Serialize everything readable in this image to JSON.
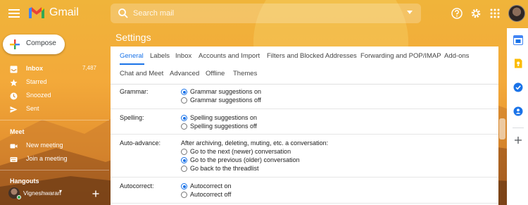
{
  "header": {
    "app_name": "Gmail",
    "search_placeholder": "Search mail"
  },
  "nav": {
    "compose_label": "Compose",
    "items": [
      {
        "label": "Inbox",
        "count": "7,487",
        "icon": "inbox-icon",
        "active": true
      },
      {
        "label": "Starred",
        "icon": "star-icon"
      },
      {
        "label": "Snoozed",
        "icon": "clock-icon"
      },
      {
        "label": "Sent",
        "icon": "send-icon"
      }
    ],
    "meet": {
      "heading": "Meet",
      "items": [
        {
          "label": "New meeting",
          "icon": "video-icon"
        },
        {
          "label": "Join a meeting",
          "icon": "keyboard-icon"
        }
      ]
    },
    "hangouts": {
      "heading": "Hangouts",
      "user": "Vigneshwaran"
    }
  },
  "settings": {
    "title": "Settings",
    "tabs": [
      {
        "label": "General",
        "active": true
      },
      {
        "label": "Labels"
      },
      {
        "label": "Inbox"
      },
      {
        "label": "Accounts and Import"
      },
      {
        "label": "Filters and Blocked Addresses"
      },
      {
        "label": "Forwarding and POP/IMAP"
      },
      {
        "label": "Add-ons"
      },
      {
        "label": "Chat and Meet"
      },
      {
        "label": "Advanced"
      },
      {
        "label": "Offline"
      },
      {
        "label": "Themes"
      }
    ],
    "rows": [
      {
        "label": "Grammar:",
        "options": [
          "Grammar suggestions on",
          "Grammar suggestions off"
        ],
        "selected": 0
      },
      {
        "label": "Spelling:",
        "options": [
          "Spelling suggestions on",
          "Spelling suggestions off"
        ],
        "selected": 0
      },
      {
        "label": "Auto-advance:",
        "description": "After archiving, deleting, muting, etc. a conversation:",
        "options": [
          "Go to the next (newer) conversation",
          "Go to the previous (older) conversation",
          "Go back to the threadlist"
        ],
        "selected": 1
      },
      {
        "label": "Autocorrect:",
        "options": [
          "Autocorrect on",
          "Autocorrect off"
        ],
        "selected": 0
      }
    ]
  },
  "colors": {
    "accent": "#1a73e8",
    "gmail_red": "#ea4335"
  }
}
